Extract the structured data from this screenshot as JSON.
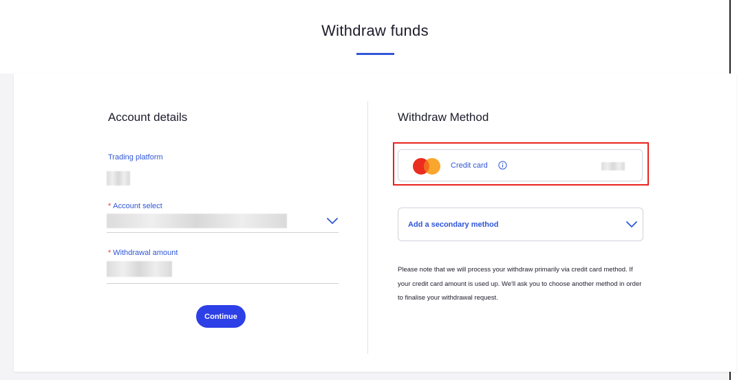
{
  "page": {
    "title": "Withdraw funds"
  },
  "account_details": {
    "title": "Account details",
    "trading_platform": {
      "label": "Trading platform"
    },
    "account_select": {
      "required_mark": "*",
      "label": "Account select"
    },
    "withdrawal_amount": {
      "required_mark": "*",
      "label": "Withdrawal amount"
    },
    "continue_label": "Continue"
  },
  "withdraw_method": {
    "title": "Withdraw Method",
    "primary": {
      "label": "Credit card",
      "icon": "mastercard-logo"
    },
    "secondary": {
      "label": "Add a secondary method"
    },
    "note": "Please note that we will process your withdraw primarily via credit card method. If your credit card amount is used up. We'll ask you to choose another method in order to finalise your withdrawal request."
  },
  "colors": {
    "accent": "#2f56d6",
    "button": "#2d3fe6",
    "highlight": "#e8201c",
    "required": "#e03a3a"
  }
}
